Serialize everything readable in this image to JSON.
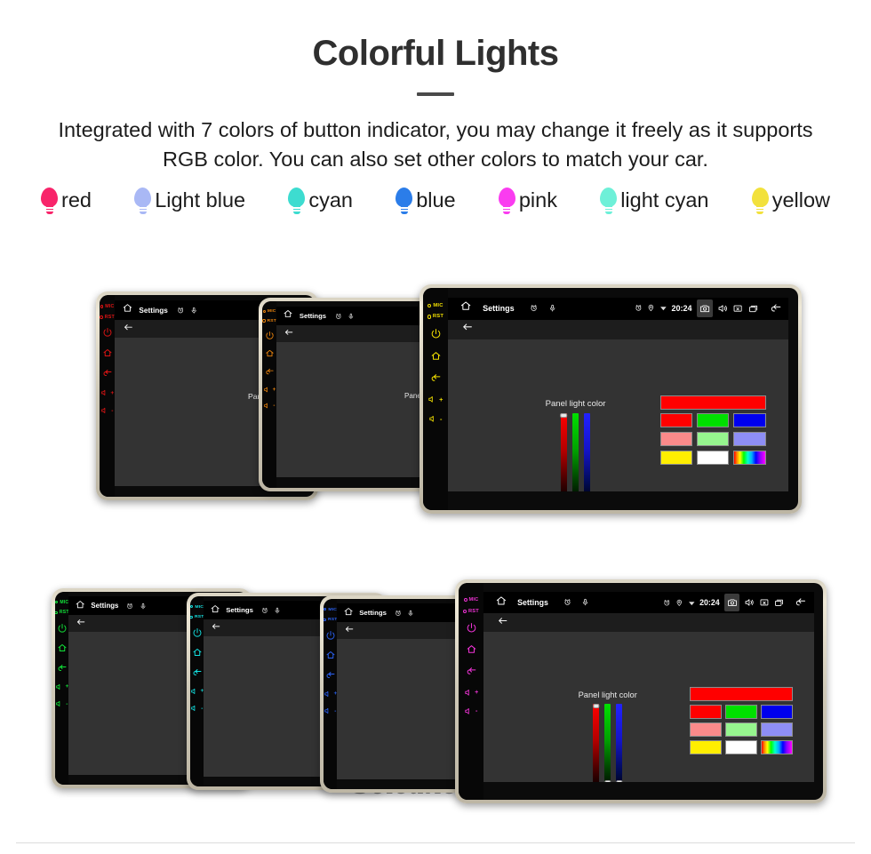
{
  "hero": {
    "title": "Colorful Lights",
    "subtitle": "Integrated with 7 colors of button indicator, you may change it freely as it supports RGB color. You can also set other colors to match your car."
  },
  "legend": {
    "items": [
      {
        "label": "red",
        "color": "#f8246a",
        "icon": "bulb-icon"
      },
      {
        "label": "Light blue",
        "color": "#a9b8f5",
        "icon": "bulb-icon"
      },
      {
        "label": "cyan",
        "color": "#3ddcd0",
        "icon": "bulb-icon"
      },
      {
        "label": "blue",
        "color": "#2b7de9",
        "icon": "bulb-icon"
      },
      {
        "label": "pink",
        "color": "#fa3cf0",
        "icon": "bulb-icon"
      },
      {
        "label": "light cyan",
        "color": "#6ef0d8",
        "icon": "bulb-icon"
      },
      {
        "label": "yellow",
        "color": "#f2e13c",
        "icon": "bulb-icon"
      }
    ]
  },
  "device": {
    "keys": {
      "mic_label": "MIC",
      "rst_label": "RST",
      "power_icon": "power-icon",
      "home_icon": "home-icon",
      "back_icon": "back-arrow-icon",
      "volup_label": "+",
      "voldown_label": "-",
      "volup_icon": "volume-up-icon",
      "voldown_icon": "volume-down-icon"
    },
    "statusbar": {
      "home_icon": "home-icon",
      "title": "Settings",
      "clock_icon": "alarm-clock-icon",
      "mic_icon": "microphone-icon",
      "alarm_icon": "alarm-icon",
      "location_icon": "location-pin-icon",
      "wifi_icon": "wifi-icon",
      "time": "20:24",
      "screenshot_icon": "camera-icon",
      "volume_icon": "speaker-icon",
      "close_icon": "close-box-icon",
      "recents_icon": "recent-apps-icon",
      "back_icon": "back-arrow-icon"
    },
    "actionbar": {
      "back_icon": "back-arrow-icon"
    },
    "panel": {
      "label": "Panel light color",
      "sliders": [
        {
          "name": "red",
          "track_color": "#ff0000",
          "value": 100
        },
        {
          "name": "green",
          "track_color": "#00e000",
          "value": 0
        },
        {
          "name": "blue",
          "track_color": "#2222ff",
          "value": 0
        }
      ],
      "preview_color": "#ff0000",
      "swatch_rows": [
        [
          "#ff0000",
          "#00e000",
          "#0000ee"
        ],
        [
          "#fa8a8a",
          "#96f58e",
          "#8e8ef5"
        ],
        [
          "#ffee00",
          "#ffffff",
          "rainbow"
        ]
      ]
    }
  },
  "rows": [
    {
      "name": "row-1",
      "units": [
        {
          "name": "unit-red",
          "key_color": "#e01414",
          "show_panel": false
        },
        {
          "name": "unit-orange",
          "key_color": "#f0860c",
          "show_panel": false
        },
        {
          "name": "unit-yellow",
          "key_color": "#f2e000",
          "show_panel": true
        }
      ]
    },
    {
      "name": "row-2",
      "units": [
        {
          "name": "unit-green",
          "key_color": "#12e83a",
          "show_panel": false
        },
        {
          "name": "unit-cyan",
          "key_color": "#14e2e2",
          "show_panel": false
        },
        {
          "name": "unit-blue",
          "key_color": "#2b62f5",
          "show_panel": false
        },
        {
          "name": "unit-magenta",
          "key_color": "#f033d6",
          "show_panel": true
        }
      ]
    }
  ],
  "watermark": {
    "text": "Seicane"
  }
}
